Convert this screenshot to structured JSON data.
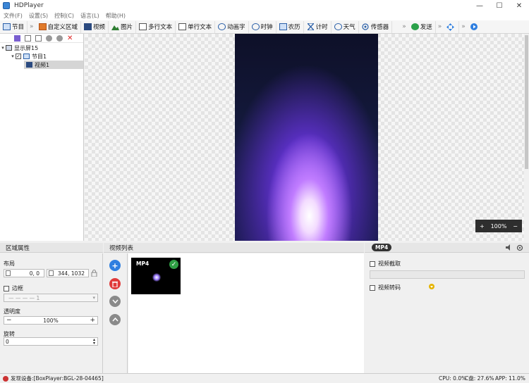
{
  "app": {
    "title": "HDPlayer"
  },
  "window_controls": {
    "minimize": "—",
    "maximize": "☐",
    "close": "✕"
  },
  "menu": [
    "文件(F)",
    "设置(S)",
    "控制(C)",
    "语言(L)",
    "帮助(H)"
  ],
  "toolbar": {
    "items": [
      {
        "label": "节目",
        "icon": "program-icon"
      },
      {
        "label": "自定义区域",
        "icon": "custom-area-icon"
      },
      {
        "label": "视频",
        "icon": "video-icon"
      },
      {
        "label": "图片",
        "icon": "picture-icon"
      },
      {
        "label": "多行文本",
        "icon": "multiline-text-icon"
      },
      {
        "label": "单行文本",
        "icon": "single-line-text-icon"
      },
      {
        "label": "动画字",
        "icon": "animated-text-icon"
      },
      {
        "label": "时钟",
        "icon": "clock-icon"
      },
      {
        "label": "农历",
        "icon": "lunar-calendar-icon"
      },
      {
        "label": "计时",
        "icon": "timer-icon"
      },
      {
        "label": "天气",
        "icon": "weather-icon"
      },
      {
        "label": "传感器",
        "icon": "sensor-icon"
      }
    ],
    "more": "»",
    "send_label": "发送"
  },
  "tree": {
    "screen": "显示屏15",
    "program": "节目1",
    "video": "视频1"
  },
  "canvas": {
    "zoom_in": "+",
    "zoom_level": "100%",
    "zoom_out": "−"
  },
  "props": {
    "header": "区域属性",
    "layout_label": "布局",
    "position": "0,  0",
    "size": "344,  1032",
    "border_label": "边框",
    "border_style": "— — — — 1",
    "opacity_label": "透明度",
    "opacity_value": "100%",
    "rotation_label": "旋转",
    "rotation_value": "0"
  },
  "video_list": {
    "header": "视频列表",
    "item_format": "MP4",
    "check": "✓"
  },
  "right_panel": {
    "badge": "MP4",
    "capture_label": "视频截取",
    "transcode_label": "视频转码"
  },
  "status": {
    "device": "发现设备:[BoxPlayer:BGL-28-04465]",
    "cpu": "CPU: 0.0%",
    "disk": "C盘: 27.6%",
    "app": "APP: 11.0%"
  },
  "colors": {
    "accent": "#2f7fe0",
    "delete": "#e03a3a",
    "gray_btn": "#8a8a8a",
    "success": "#2f9e44"
  }
}
